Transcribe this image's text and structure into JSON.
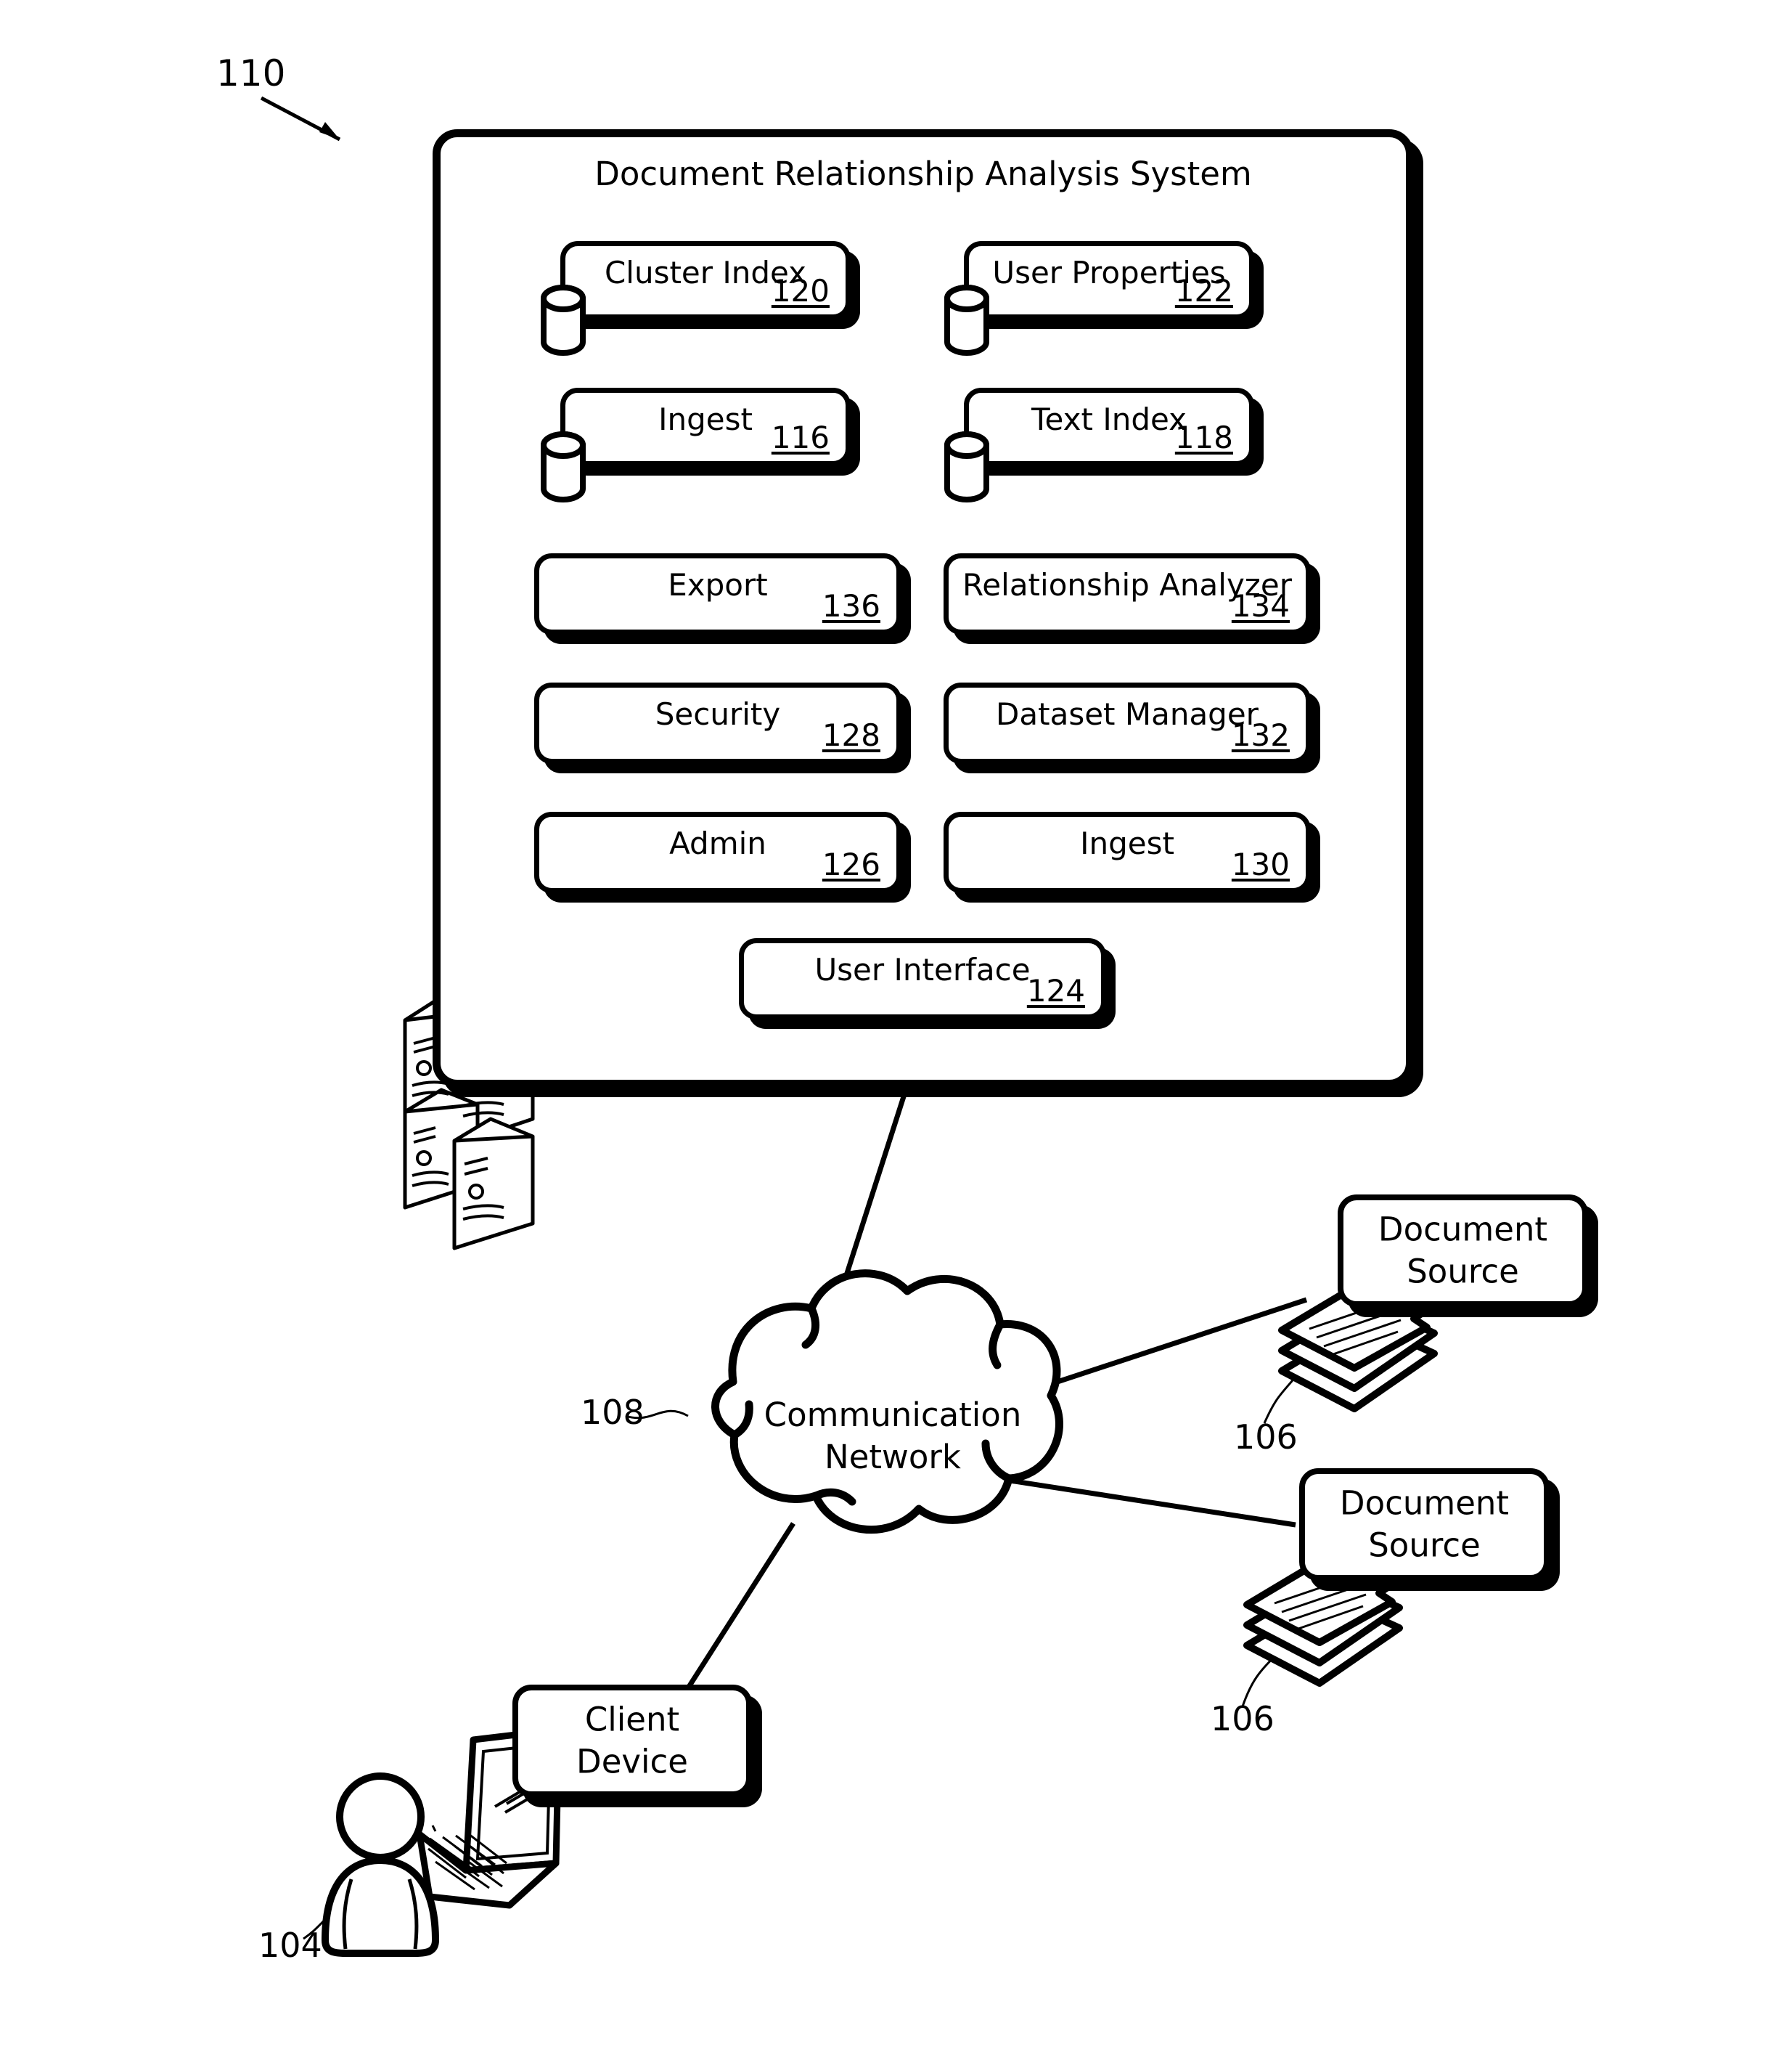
{
  "figure": {
    "reference": "110",
    "system_title": "Document Relationship Analysis System"
  },
  "system": {
    "title": "Document Relationship Analysis System",
    "components": [
      {
        "label": "Cluster Index",
        "ref": "120",
        "icon": "database-cylinder-icon"
      },
      {
        "label": "User Properties",
        "ref": "122",
        "icon": "database-cylinder-icon"
      },
      {
        "label": "Ingest",
        "ref": "116",
        "icon": "database-cylinder-icon"
      },
      {
        "label": "Text Index",
        "ref": "118",
        "icon": "database-cylinder-icon"
      },
      {
        "label": "Export",
        "ref": "136",
        "icon": ""
      },
      {
        "label": "Relationship Analyzer",
        "ref": "134",
        "icon": ""
      },
      {
        "label": "Security",
        "ref": "128",
        "icon": ""
      },
      {
        "label": "Dataset Manager",
        "ref": "132",
        "icon": ""
      },
      {
        "label": "Admin",
        "ref": "126",
        "icon": ""
      },
      {
        "label": "Ingest",
        "ref": "130",
        "icon": ""
      },
      {
        "label": "User Interface",
        "ref": "124",
        "icon": ""
      }
    ],
    "server_icon": "server-rack-icon"
  },
  "network": {
    "label_line1": "Communication",
    "label_line2": "Network",
    "ref": "108",
    "icon": "cloud-icon"
  },
  "document_sources": [
    {
      "label_line1": "Document",
      "label_line2": "Source",
      "ref": "106",
      "icon": "document-stack-icon"
    },
    {
      "label_line1": "Document",
      "label_line2": "Source",
      "ref": "106",
      "icon": "document-stack-icon"
    }
  ],
  "client": {
    "label_line1": "Client",
    "label_line2": "Device",
    "user_ref": "104",
    "device_icon": "laptop-icon",
    "user_icon": "person-icon"
  },
  "colors": {
    "ink": "#000000",
    "paper": "#ffffff"
  }
}
